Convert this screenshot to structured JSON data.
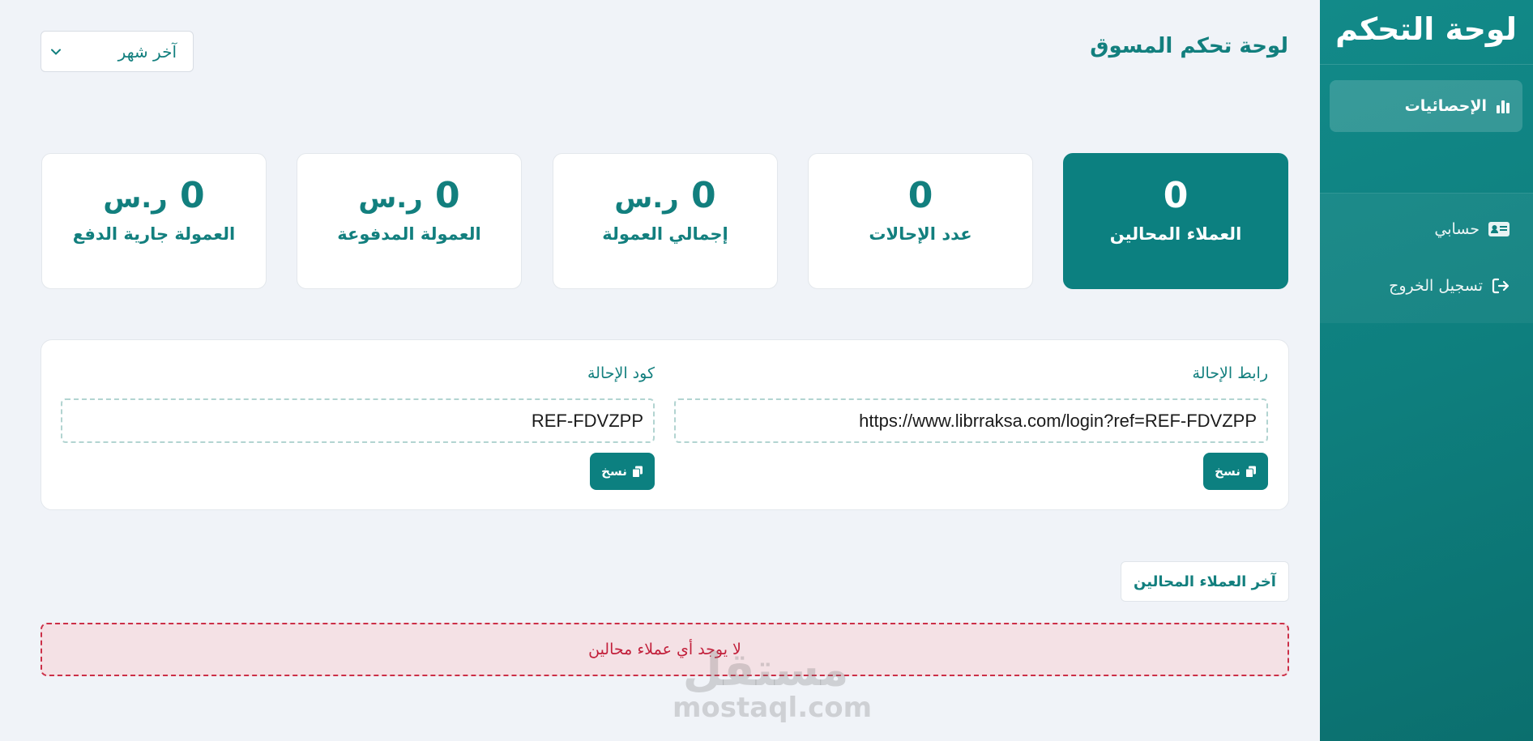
{
  "sidebar": {
    "title": "لوحة التحكم",
    "items": [
      {
        "label": "الإحصائيات",
        "icon": "bar-chart-icon",
        "active": true
      },
      {
        "label": "حسابي",
        "icon": "id-card-icon",
        "active": false
      },
      {
        "label": "تسجيل الخروج",
        "icon": "logout-icon",
        "active": false
      }
    ]
  },
  "header": {
    "title": "لوحة تحكم المسوق",
    "period_select": {
      "value": "آخر شهر",
      "icon": "chevron-down-icon"
    }
  },
  "stats": [
    {
      "value": "0",
      "unit": "",
      "label": "العملاء المحالين",
      "active": true
    },
    {
      "value": "0",
      "unit": "",
      "label": "عدد الإحالات",
      "active": false
    },
    {
      "value": "0",
      "unit": "ر.س",
      "label": "إجمالي العمولة",
      "active": false
    },
    {
      "value": "0",
      "unit": "ر.س",
      "label": "العمولة المدفوعة",
      "active": false
    },
    {
      "value": "0",
      "unit": "ر.س",
      "label": "العمولة جارية الدفع",
      "active": false
    }
  ],
  "referral": {
    "link_label": "رابط الإحالة",
    "link_value": "https://www.librraksa.com/login?ref=REF-FDVZPP",
    "code_label": "كود الإحالة",
    "code_value": "REF-FDVZPP",
    "copy_label": "نسخ",
    "copy_icon": "copy-icon"
  },
  "recent": {
    "tab_label": "آخر العملاء المحالين",
    "empty_message": "لا يوجد أي عملاء محالين"
  },
  "watermark": {
    "ar": "مستقل",
    "en": "mostaql.com"
  },
  "colors": {
    "primary": "#0c8080",
    "sidebar": "#0e7f7e",
    "background": "#f0f3f8",
    "alert_border": "#cc2f47",
    "alert_bg": "#f4e1e5"
  }
}
